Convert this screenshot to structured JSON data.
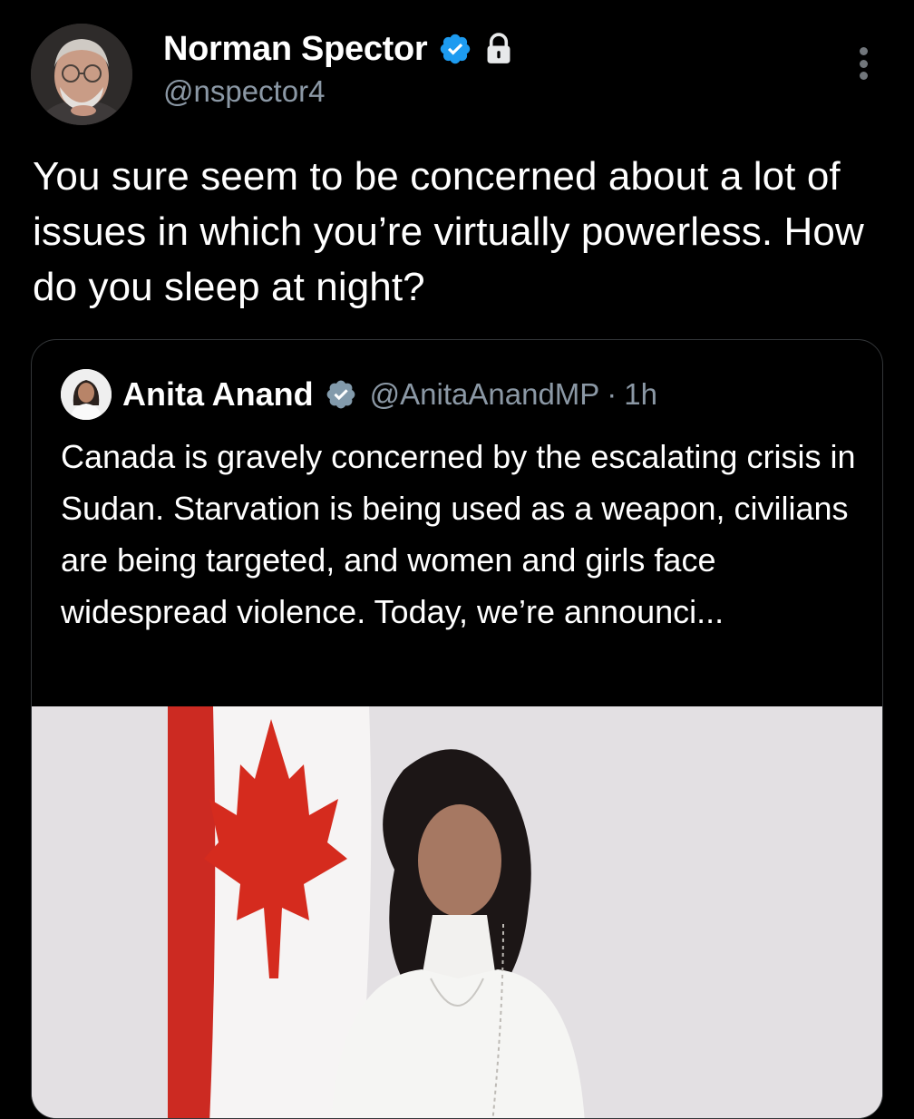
{
  "author": {
    "name": "Norman Spector",
    "handle": "@nspector4",
    "verified_icon": "verified-badge-icon",
    "lock_icon": "lock-icon"
  },
  "tweet": {
    "text": "You sure seem to be concerned about a lot of issues in which you’re virtually powerless. How do you sleep at night?"
  },
  "quote": {
    "name": "Anita Anand",
    "handle": "@AnitaAnandMP",
    "separator": "·",
    "time": "1h",
    "text": "Canada is gravely concerned by the escalating crisis in Sudan. Starvation is being used as a weapon, civilians are being targeted, and women and girls face widespread violence. Today, we’re announci..."
  },
  "colors": {
    "background": "#000000",
    "text_primary": "#ffffff",
    "text_secondary": "#8b98a5",
    "verified_blue": "#1d9bf0",
    "verified_gray": "#829aab",
    "border": "#333639",
    "flag_red": "#d52b1e"
  }
}
